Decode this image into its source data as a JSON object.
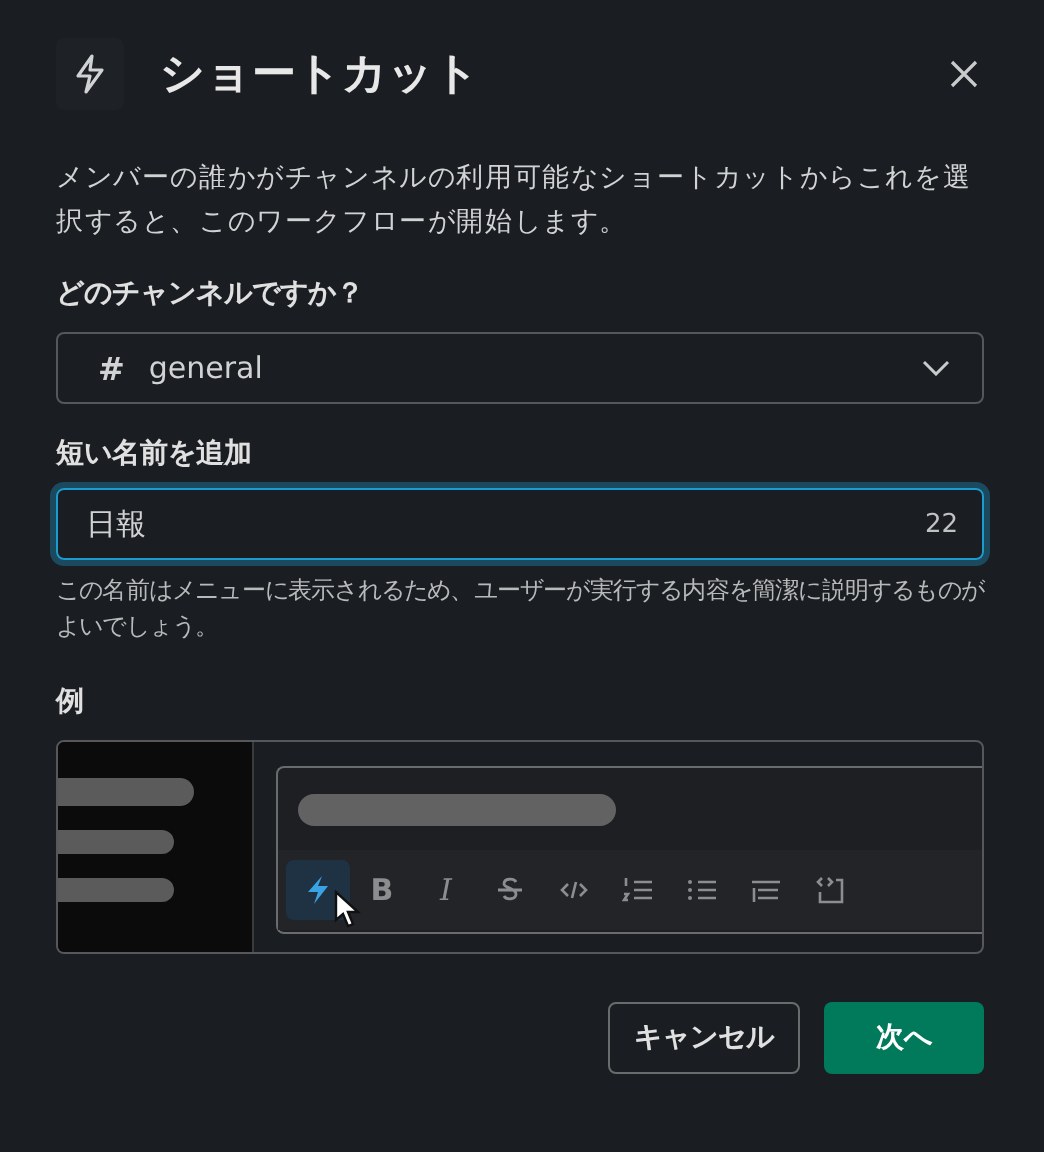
{
  "dialog": {
    "title": "ショートカット",
    "description": "メンバーの誰かがチャンネルの利用可能なショートカットからこれを選択すると、このワークフローが開始します。"
  },
  "channel": {
    "label": "どのチャンネルですか？",
    "prefix": "#",
    "value": "general"
  },
  "name_field": {
    "label": "短い名前を追加",
    "value": "日報",
    "count": "22",
    "hint": "この名前はメニューに表示されるため、ユーザーが実行する内容を簡潔に説明するものがよいでしょう。"
  },
  "example": {
    "label": "例",
    "toolbar": [
      {
        "kind": "shortcut",
        "selected": true
      },
      {
        "kind": "bold",
        "label": "B",
        "selected": false
      },
      {
        "kind": "italic",
        "label": "I",
        "selected": false
      },
      {
        "kind": "strike",
        "selected": false
      },
      {
        "kind": "code",
        "selected": false
      },
      {
        "kind": "ordered",
        "selected": false
      },
      {
        "kind": "bullet",
        "selected": false
      },
      {
        "kind": "quote",
        "selected": false
      },
      {
        "kind": "codeblock",
        "selected": false
      }
    ]
  },
  "buttons": {
    "cancel": "キャンセル",
    "next": "次へ"
  }
}
